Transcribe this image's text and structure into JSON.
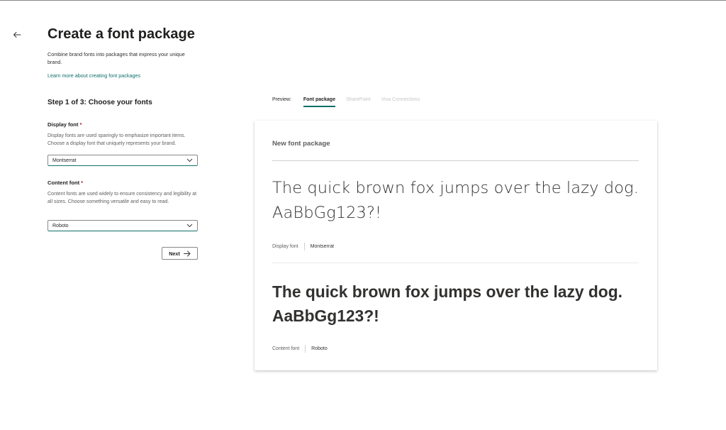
{
  "header": {
    "title": "Create a font package",
    "subtitle": "Combine brand fonts into packages that express your unique brand.",
    "learn_more": "Learn more about creating font packages"
  },
  "step": {
    "title": "Step 1 of 3: Choose your fonts"
  },
  "display_font": {
    "label": "Display font",
    "required_mark": "*",
    "description": "Display fonts are used sparingly to emphasize important items. Choose a display font that uniquely represents your brand.",
    "value": "Montserrat"
  },
  "content_font": {
    "label": "Content font",
    "required_mark": "*",
    "description": "Content fonts are used widely to ensure consistency and legibility at all sizes. Choose something versatile and easy to read.",
    "value": "Roboto"
  },
  "actions": {
    "next_label": "Next"
  },
  "preview": {
    "label": "Preview:",
    "tabs": [
      {
        "label": "Font package",
        "state": "active"
      },
      {
        "label": "SharePoint",
        "state": "disabled"
      },
      {
        "label": "Viva Connections",
        "state": "disabled"
      }
    ]
  },
  "card": {
    "title": "New font package",
    "display_sample": "The quick brown fox jumps over the lazy dog. AaBbGg123?!",
    "display_meta_key": "Display font",
    "display_meta_value": "Montserrat",
    "content_sample": "The quick brown fox jumps over the lazy dog. AaBbGg123?!",
    "content_meta_key": "Content font",
    "content_meta_value": "Roboto"
  },
  "colors": {
    "accent": "#0f6f6a",
    "required": "#a4262c",
    "text_primary": "#201f1e",
    "text_secondary": "#605e5c",
    "disabled": "#c8c6c4"
  },
  "icons": {
    "back": "arrow-left-icon",
    "dropdown": "chevron-down-icon",
    "next": "arrow-right-icon"
  }
}
